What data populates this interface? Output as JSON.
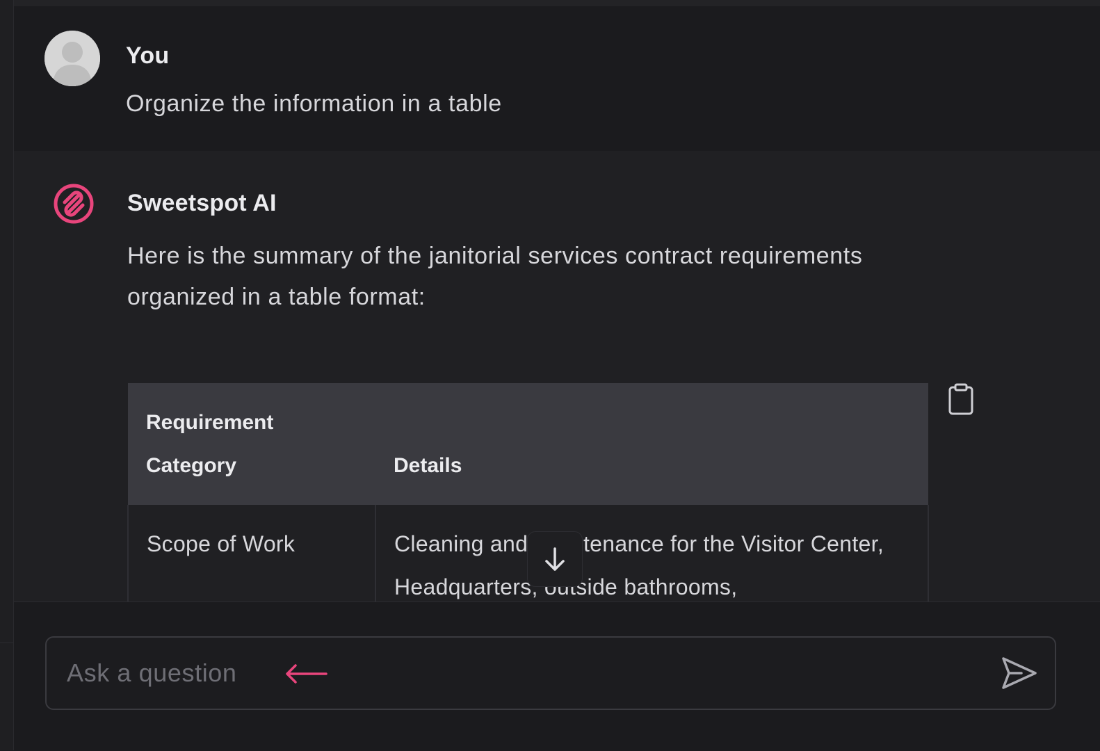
{
  "user_message": {
    "sender": "You",
    "text": "Organize the information in a table"
  },
  "ai_message": {
    "sender": "Sweetspot AI",
    "text": "Here is the summary of the janitorial services contract requirements organized in a table format:",
    "table": {
      "headers": [
        "Requirement Category",
        "Details"
      ],
      "rows": [
        {
          "category": "Scope of Work",
          "details": "Cleaning and maintenance for the Visitor Center, Headquarters, outside bathrooms,"
        }
      ]
    }
  },
  "input": {
    "placeholder": "Ask a question"
  },
  "colors": {
    "brand_accent": "#e8457c",
    "background": "#1b1b1e",
    "table_header": "#3a3a40"
  },
  "icons": {
    "avatar": "user-avatar-icon",
    "logo": "sweetspot-logo-icon",
    "copy": "clipboard-icon",
    "scroll": "arrow-down-icon",
    "send": "send-icon",
    "annotation": "arrow-left-icon"
  }
}
